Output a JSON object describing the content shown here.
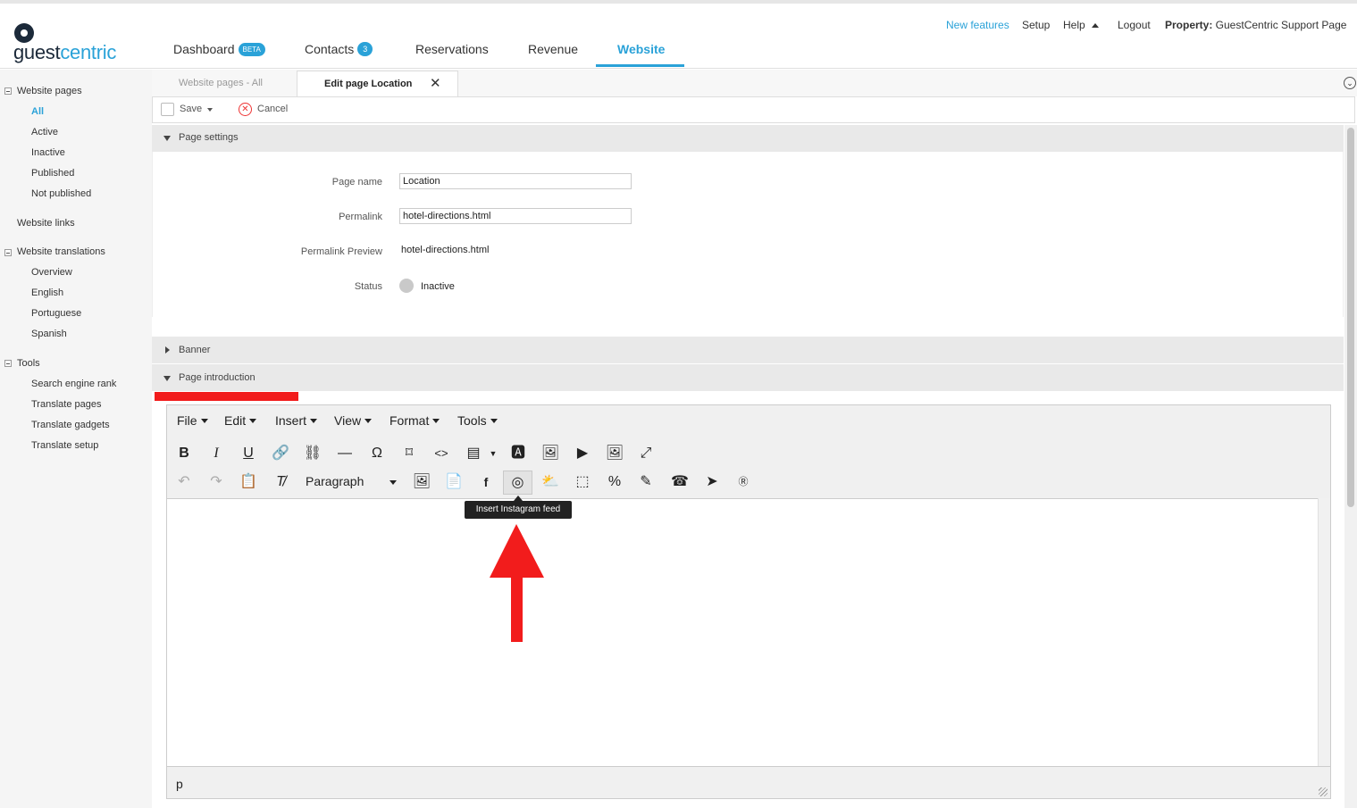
{
  "logo": {
    "part1": "guest",
    "part2": "centric"
  },
  "topnav": {
    "new_features": "New features",
    "setup": "Setup",
    "help": "Help",
    "logout": "Logout",
    "property_label": "Property:",
    "property_value": " GuestCentric Support Page"
  },
  "maintabs": {
    "dashboard": "Dashboard",
    "dashboard_badge": "BETA",
    "contacts": "Contacts",
    "contacts_badge": "3",
    "reservations": "Reservations",
    "revenue": "Revenue",
    "website": "Website"
  },
  "sidebar": {
    "website_pages": "Website pages",
    "pages_items": [
      "All",
      "Active",
      "Inactive",
      "Published",
      "Not published"
    ],
    "website_links": "Website links",
    "website_translations": "Website translations",
    "translation_items": [
      "Overview",
      "English",
      "Portuguese",
      "Spanish"
    ],
    "tools": "Tools",
    "tools_items": [
      "Search engine rank",
      "Translate pages",
      "Translate gadgets",
      "Translate setup"
    ]
  },
  "subtabs": {
    "all": "Website pages - All",
    "edit": "Edit page Location"
  },
  "actions": {
    "save": "Save",
    "cancel": "Cancel"
  },
  "sections": {
    "page_settings": "Page settings",
    "banner": "Banner",
    "page_introduction": "Page introduction"
  },
  "form": {
    "page_name_label": "Page name",
    "page_name_value": "Location",
    "permalink_label": "Permalink",
    "permalink_value": "hotel-directions.html",
    "permalink_preview_label": "Permalink Preview",
    "permalink_preview_value": "hotel-directions.html",
    "status_label": "Status",
    "status_value": "Inactive"
  },
  "editor": {
    "menus": [
      "File",
      "Edit",
      "Insert",
      "View",
      "Format",
      "Tools"
    ],
    "format_select": "Paragraph",
    "path": "p",
    "tooltip": "Insert Instagram feed"
  },
  "colors": {
    "accent": "#2aa2d8",
    "annotation_red": "#f21c1c"
  }
}
